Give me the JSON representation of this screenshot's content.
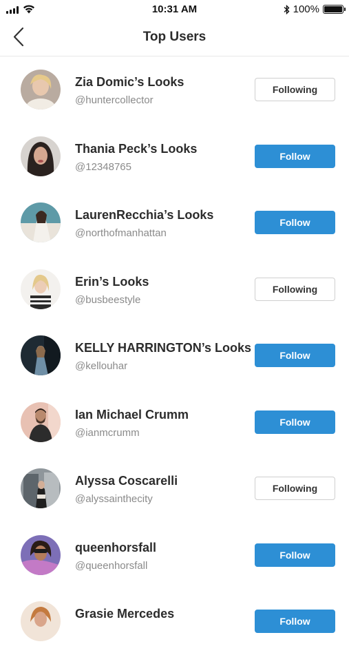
{
  "status_bar": {
    "time": "10:31 AM",
    "battery": "100%"
  },
  "nav": {
    "title": "Top Users",
    "back_icon": "chevron-left-icon"
  },
  "colors": {
    "follow_blue": "#2d8fd5",
    "following_border": "#cfcfcf"
  },
  "users": [
    {
      "name": "Zia Domic’s Looks",
      "handle": "@huntercollector",
      "button": "Following"
    },
    {
      "name": "Thania Peck’s Looks",
      "handle": "@12348765",
      "button": "Follow"
    },
    {
      "name": "LaurenRecchia’s Looks",
      "handle": "@northofmanhattan",
      "button": "Follow"
    },
    {
      "name": "Erin’s Looks",
      "handle": "@busbeestyle",
      "button": "Following"
    },
    {
      "name": "KELLY HARRINGTON’s Looks",
      "handle": "@kellouhar",
      "button": "Follow"
    },
    {
      "name": "Ian Michael Crumm",
      "handle": "@ianmcrumm",
      "button": "Follow"
    },
    {
      "name": "Alyssa Coscarelli",
      "handle": "@alyssainthecity",
      "button": "Following"
    },
    {
      "name": "queenhorsfall",
      "handle": "@queenhorsfall",
      "button": "Follow"
    },
    {
      "name": "Grasie Mercedes",
      "handle": "",
      "button": "Follow"
    }
  ]
}
